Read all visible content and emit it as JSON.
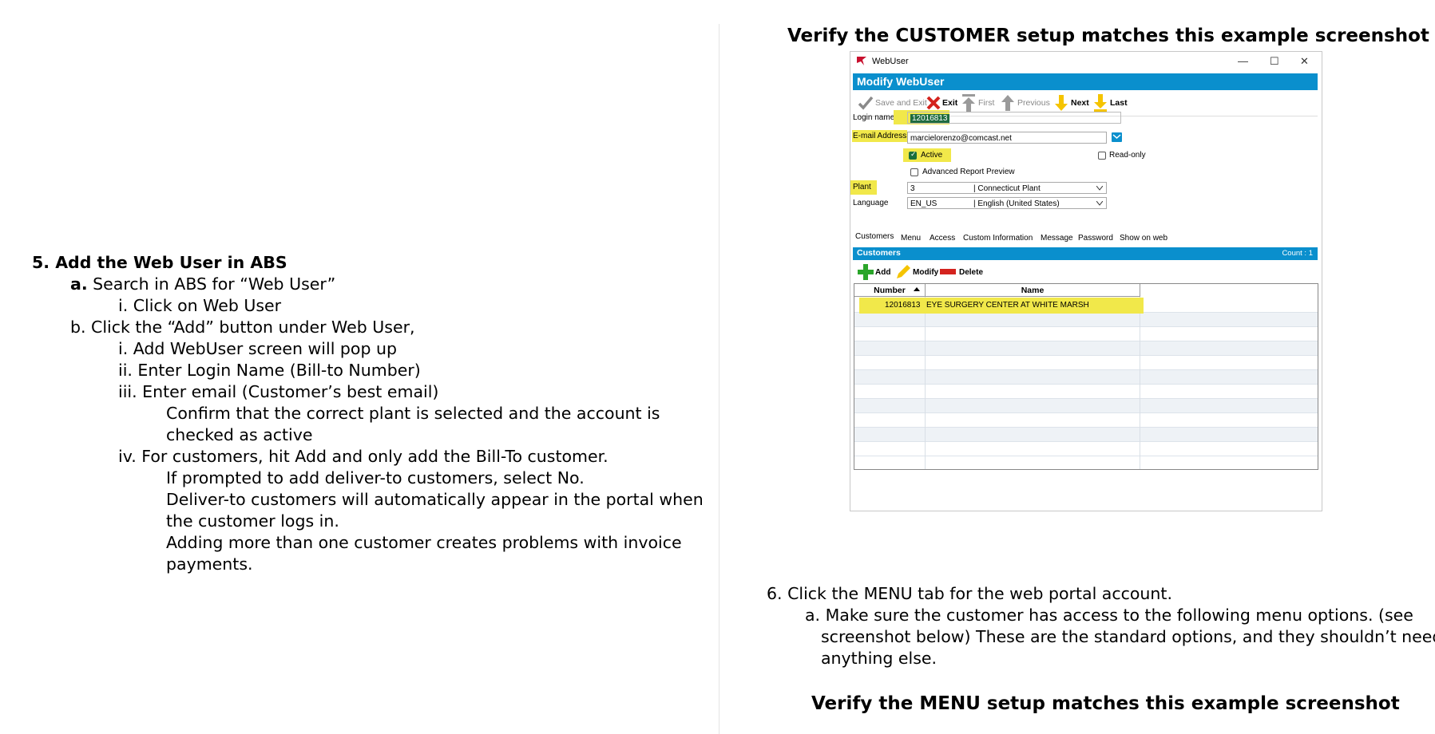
{
  "left": {
    "step5_title": "5. Add the Web User in ABS",
    "a_prefix": "a.",
    "a_text": " Search in ABS for “Web User”",
    "a_i": "i. Click on Web User",
    "b_text": "b. Click the “Add” button under Web User,",
    "b_i": "i. Add WebUser screen will pop up",
    "b_ii": "ii. Enter Login Name (Bill-to Number)",
    "b_iii": "iii. Enter email (Customer’s best email)",
    "b_iii_note_1": "Confirm that the correct plant is selected and the account is",
    "b_iii_note_2": "checked as active",
    "b_iv": "iv. For customers, hit Add and only add the Bill-To customer.",
    "b_iv_note_1": "If prompted to add deliver-to customers, select No.",
    "b_iv_note_2": "Deliver-to customers will automatically appear in the portal when",
    "b_iv_note_3": "the customer logs in.",
    "b_iv_note_4": "Adding more than one customer creates problems with invoice",
    "b_iv_note_5": "payments."
  },
  "right": {
    "customer_heading": "Verify the CUSTOMER setup matches this example screenshot",
    "step6_title": "6. Click the MENU tab for the web portal account.",
    "step6_a_1": "a. Make sure the customer has access to the following menu options. (see",
    "step6_a_2": "screenshot below) These are the standard options, and they shouldn’t need",
    "step6_a_3": "anything else.",
    "menu_heading": "Verify the MENU setup matches this example screenshot"
  },
  "window": {
    "title": "WebUser",
    "controls": {
      "minimize": "—",
      "maximize": "☐",
      "close": "✕"
    },
    "header": "Modify WebUser",
    "toolbar": {
      "save_exit": "Save and Exit",
      "exit": "Exit",
      "first": "First",
      "previous": "Previous",
      "next": "Next",
      "last": "Last"
    },
    "login_label": "Login name",
    "login_value": "12016813",
    "email_label": "E-mail Address",
    "email_value": "marcielorenzo@comcast.net",
    "active_label": "Active",
    "readonly_label": "Read-only",
    "adv_preview_label": "Advanced Report Preview",
    "plant_label": "Plant",
    "plant_code": "3",
    "plant_name": "| Connecticut Plant",
    "language_label": "Language",
    "language_code": "EN_US",
    "language_name": "| English (United States)",
    "tabs": [
      "Customers",
      "Menu",
      "Access",
      "Custom Information",
      "Message",
      "Password",
      "Show on web"
    ],
    "customers_bar": "Customers",
    "count_text": "Count : 1",
    "actions": {
      "add": "Add",
      "modify": "Modify",
      "delete": "Delete"
    },
    "grid_headers": {
      "number": "Number",
      "name": "Name"
    },
    "rows": [
      {
        "number": "12016813",
        "name": "EYE SURGERY CENTER AT WHITE MARSH"
      }
    ],
    "colors": {
      "header_blue": "#0a8fcd",
      "highlight": "#f1e84a",
      "exit_red": "#d4231e",
      "arrow_yellow": "#f5c400",
      "add_green": "#2aa52a"
    }
  }
}
